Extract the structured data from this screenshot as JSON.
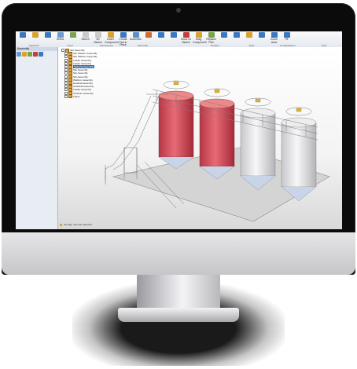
{
  "window": {
    "title": ""
  },
  "ribbon": {
    "buttons": [
      {
        "label": "",
        "icon": "new-icon",
        "color": "#3b78c2"
      },
      {
        "label": "",
        "icon": "open-icon",
        "color": "#d9a12e"
      },
      {
        "label": "",
        "icon": "save-icon",
        "color": "#3b78c2"
      },
      {
        "label": "Select",
        "icon": "select-icon",
        "color": "#6a9bd1"
      },
      {
        "label": "",
        "icon": "move-icon",
        "color": "#7aa34a"
      },
      {
        "label": "Sketch",
        "icon": "sketch-icon",
        "color": "#c9c9c9"
      },
      {
        "label": "3D Sketch",
        "icon": "sketch3d-icon",
        "color": "#c9c9c9"
      },
      {
        "label": "Insert Component",
        "icon": "insert-component-icon",
        "color": "#d9a12e"
      },
      {
        "label": "Create Part in Place",
        "icon": "create-part-icon",
        "color": "#3b78c2"
      },
      {
        "label": "Assemble",
        "icon": "assemble-icon",
        "color": "#5a8fcf"
      },
      {
        "label": "",
        "icon": "mate-icon",
        "color": "#d06a30"
      },
      {
        "label": "",
        "icon": "pattern-icon",
        "color": "#3b78c2"
      },
      {
        "label": "",
        "icon": "mirror-icon",
        "color": "#3b78c2"
      },
      {
        "label": "Show on Sketch",
        "icon": "show-icon",
        "color": "#c73c3c"
      },
      {
        "label": "Drag Component",
        "icon": "drag-icon",
        "color": "#d9a12e"
      },
      {
        "label": "Replace Part",
        "icon": "replace-icon",
        "color": "#7aa34a"
      },
      {
        "label": "",
        "icon": "measure-icon",
        "color": "#3b78c2"
      },
      {
        "label": "",
        "icon": "section-icon",
        "color": "#3b78c2"
      },
      {
        "label": "",
        "icon": "config-icon",
        "color": "#d9a12e"
      },
      {
        "label": "",
        "icon": "table-icon",
        "color": "#3b78c2"
      },
      {
        "label": "Zoom Area",
        "icon": "zoom-icon",
        "color": "#3b78c2"
      },
      {
        "label": "Fit",
        "icon": "fit-icon",
        "color": "#3b78c2"
      }
    ],
    "groups": [
      "Clipboard",
      "Insert",
      "Components",
      "Assemble",
      "",
      "Position",
      "Tools",
      "Configurations",
      "View"
    ]
  },
  "left_panel": {
    "title": "Assembly",
    "tools": [
      "#6a9bd1",
      "#d9a12e",
      "#7aa34a",
      "#c73c3c",
      "#3b78c2"
    ]
  },
  "tree": [
    {
      "label": "Silo Assembly",
      "selected": false
    },
    {
      "label": "Silo Platform Assembly",
      "selected": false
    },
    {
      "label": "Silo Platform Assembly",
      "selected": false
    },
    {
      "label": "Ladder Assembly",
      "selected": false
    },
    {
      "label": "Ladder Assembly",
      "selected": false
    },
    {
      "label": "Stairway Assembly",
      "selected": true
    },
    {
      "label": "Silo Assembly",
      "selected": false
    },
    {
      "label": "Silo Assembly",
      "selected": false
    },
    {
      "label": "Silo Assembly",
      "selected": false
    },
    {
      "label": "Platform Assembly",
      "selected": false
    },
    {
      "label": "Handrail Assembly",
      "selected": false
    },
    {
      "label": "Guardrail Assembly",
      "selected": false
    },
    {
      "label": "Ladder Assembly",
      "selected": false
    },
    {
      "label": "Structure Assembly",
      "selected": false
    },
    {
      "label": "Frame",
      "selected": false
    }
  ],
  "status": {
    "text": "Set flag: next part selected."
  },
  "colors": {
    "silo_red": "#d64a58",
    "silo_white": "#e6e6ea",
    "frame": "#8a8a8a",
    "accent": "#3b78c2"
  }
}
